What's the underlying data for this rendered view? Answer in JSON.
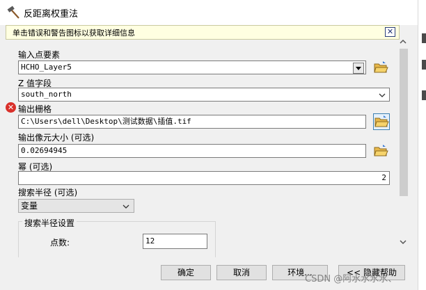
{
  "window": {
    "title": "反距离权重法"
  },
  "message_bar": {
    "text": "单击错误和警告图标以获取详细信息",
    "close_symbol": "✕"
  },
  "params": {
    "input_points": {
      "label": "输入点要素",
      "value": "HCHO_Layer5"
    },
    "z_field": {
      "label": "Z 值字段",
      "value": "south_north"
    },
    "output_raster": {
      "label": "输出栅格",
      "value": "C:\\Users\\dell\\Desktop\\测试数据\\插值.tif",
      "error_symbol": "✕"
    },
    "cell_size": {
      "label": "输出像元大小 (可选)",
      "value": "0.02694945"
    },
    "power": {
      "label": "幂 (可选)",
      "value": "2"
    },
    "search_radius": {
      "label": "搜索半径 (可选)",
      "value": "变量"
    },
    "search_settings": {
      "legend": "搜索半径设置",
      "points_label": "点数:",
      "points_value": "12"
    }
  },
  "buttons": {
    "ok": "确定",
    "cancel": "取消",
    "env": "环境...",
    "hide_help": "<< 隐藏帮助"
  },
  "watermark": "CSDN @阿水水水水、",
  "colors": {
    "error": "#d9302a",
    "message_bg": "#ffffe1",
    "accent_border": "#3c7fb1"
  }
}
